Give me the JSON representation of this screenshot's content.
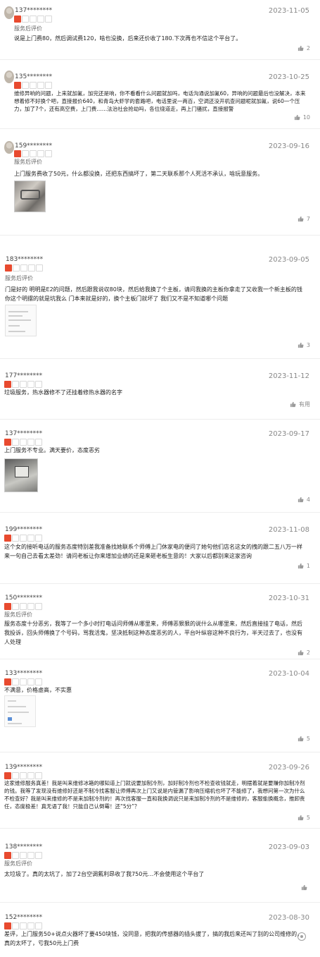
{
  "reviews": [
    {
      "user": "137********",
      "date": "2023-11-05",
      "rating": 1,
      "tag": "服务后评价",
      "content": "说是上门费80，然后调试费120，啥也没换，后来还价收了180.下次再也不信这个平台了。",
      "likes": "2",
      "like_icon": "thumbs-up-icon"
    },
    {
      "user": "135********",
      "date": "2023-10-25",
      "rating": 1,
      "tag": "",
      "content": "维修异响的问题，上来就加氟，加完还是响，你不看看什么问题就加吗，电话沟通说加氟60，异响的问题最后也没解决，本来想着修不好换个吧，直接报价640，和青岛大虾学的套路吧，电话里说一两百，空调还没开机查问题呢就加氟，说60一个压力，加了7个，还有高空费，上门费……法治社会抢劫吗，各位绕道走，再上门骚扰，直接报警",
      "likes": "10",
      "like_icon": "thumbs-up-icon"
    },
    {
      "user": "159********",
      "date": "2023-09-16",
      "rating": 1,
      "tag": "服务后评价",
      "content": "上门服务费收了50元，什么都没换，还把东西搞坏了，第二天联系那个人死活不承认，啥玩意服务。",
      "likes": "7",
      "like_icon": "thumbs-up-icon",
      "image": "repair-photo"
    },
    {
      "user": "183********",
      "date": "2023-09-05",
      "rating": 1,
      "tag": "服务后评价",
      "content": "门是好的 明明是E2的问题，然后跟我说収80块，然后给我换了个主板，请问我换的主板你拿走了又收我一个新主板的钱 你这个明摆的就是坑我么 门本来就是好的，换个主板门就坏了 我们又不是不知道哪个问题",
      "likes": "3",
      "like_icon": "thumbs-up-icon",
      "image": "document-screenshot"
    },
    {
      "user": "177********",
      "date": "2023-11-12",
      "rating": 1,
      "tag": "",
      "content": "垃圾服务，热水器修不了还挂着修热水器的名字",
      "likes": "有用",
      "like_icon": "thumbs-up-icon"
    },
    {
      "user": "137********",
      "date": "2023-09-17",
      "rating": 1,
      "tag": "",
      "content": "上门服务不专业。满天要价，态度恶劣",
      "likes": "4",
      "like_icon": "thumbs-up-icon",
      "image": "device-photo"
    },
    {
      "user": "199********",
      "date": "2023-11-08",
      "rating": 1,
      "tag": "",
      "content": "这个女的接听电话的服务态度特别差我准备找她联系个师傅上门休家电的便问了她句他们店名这女的拽的跟二五八万一样来一句自己去看太差劲！请问老板让你来增加业绩的还是来砸老板生意的！大家以后都别来这家咨询",
      "likes": "1",
      "like_icon": "thumbs-up-icon"
    },
    {
      "user": "150********",
      "date": "2023-10-31",
      "rating": 1,
      "tag": "服务后评价",
      "content": "服务态度十分恶劣，我等了一个多小时打电话问师傅从哪里来，师傅恶狠狠的说什么从哪里来，然后直接挂了电话，然后我投诉，回头师傅换了个号码，骂我活鬼，坚决抵制这种态度恶劣的人，平台叶纵容这种不良行为，半天过去了，也没有人处理",
      "likes": "2",
      "like_icon": "thumbs-up-icon"
    },
    {
      "user": "133********",
      "date": "2023-10-04",
      "rating": 1,
      "tag": "",
      "content": "不满意，价格虚高，不实惠",
      "likes": "5",
      "like_icon": "thumbs-up-icon",
      "image": "app-screenshot"
    },
    {
      "user": "139********",
      "date": "2023-09-26",
      "rating": 1,
      "tag": "",
      "content": "这家维修服务真差！我是叫来维修冰箱的哪知道上门就说要加制冷剂，加好制冷剂也不检查收钱就走，明摆着就是要赚你加制冷剂的钱。我等了发现没有维修好还是不制冷找客服让师傅再次上门又说是内管漏了影响压缩机也坏了不能修了，我想问第一次为什么不检查好？我是叫来维修的不是来加制冷剂的！再次找客服一直和我换调说只是来加制冷剂的不是维修的，客服偷换概念，推卸责任，态度极差！真无语了我！只能自己认倒霉！还“5分”？",
      "likes": "5",
      "like_icon": "thumbs-up-icon"
    },
    {
      "user": "138********",
      "date": "2023-09-03",
      "rating": 1,
      "tag": "服务后评价",
      "content": "太垃圾了。真的太坑了，加了2台空调氟利昂收了我750元…不会使用这个平台了",
      "likes": "",
      "like_icon": "thumbs-up-icon"
    },
    {
      "user": "152********",
      "date": "2023-08-30",
      "rating": 1,
      "tag": "",
      "content": "差评，上门服务50+说点火器坏了要450块钱，没同意，把我的传感器的插头拔了，搞的我后来还叫了别的公司维修的，真的太坏了，亏我50元上门费",
      "likes": "",
      "like_icon": "thumbs-up-icon"
    }
  ],
  "watermark": {
    "text": "",
    "icon": "weibo-watermark-icon"
  }
}
